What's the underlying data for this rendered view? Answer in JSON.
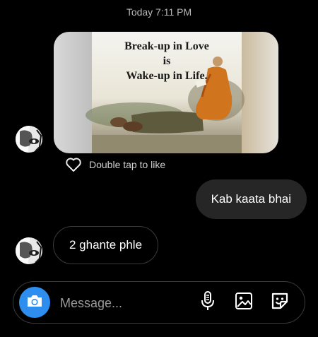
{
  "thread": {
    "timestamp": "Today 7:11 PM"
  },
  "image_message": {
    "caption_lines": [
      "Break-up in Love",
      "is",
      "Wake-up in Life."
    ],
    "like_hint": "Double tap to like"
  },
  "messages": [
    {
      "direction": "outgoing",
      "text": "Kab kaata bhai"
    },
    {
      "direction": "incoming",
      "text": "2 ghante phle"
    }
  ],
  "composer": {
    "placeholder": "Message...",
    "icons": [
      "camera-icon",
      "microphone-icon",
      "gallery-icon",
      "sticker-icon"
    ]
  },
  "colors": {
    "background": "#000000",
    "outgoing_bubble": "#262626",
    "camera_button": "#2d8ef0"
  }
}
